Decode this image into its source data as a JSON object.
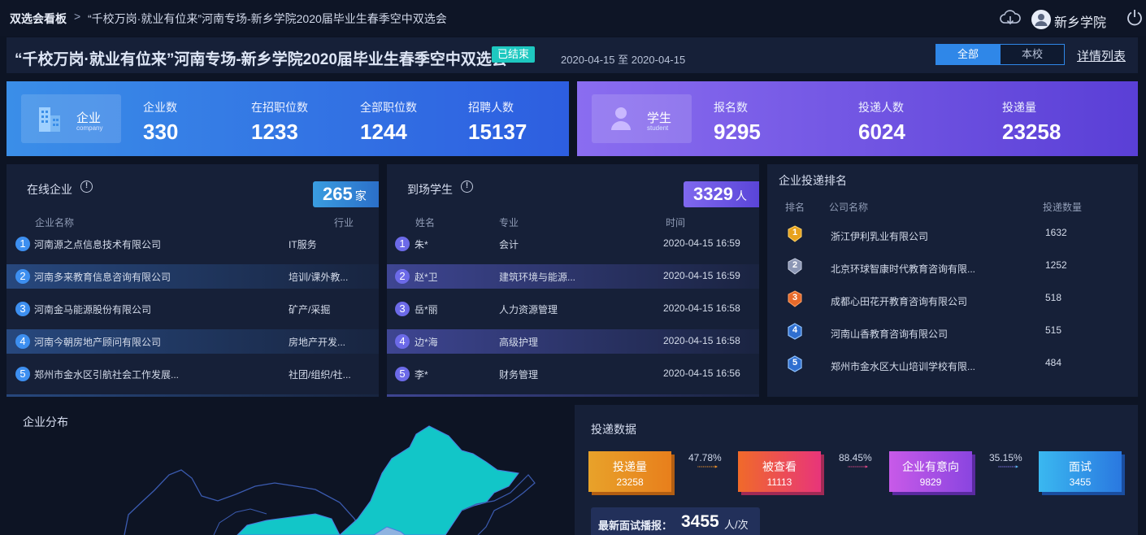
{
  "topbar": {
    "breadcrumb_home": "双选会看板",
    "breadcrumb_sep": ">",
    "breadcrumb_current": "“千校万岗·就业有位来”河南专场-新乡学院2020届毕业生春季空中双选会",
    "school_name": "新乡学院"
  },
  "titlebar": {
    "title": "“千校万岗·就业有位来”河南专场-新乡学院2020届毕业生春季空中双选会",
    "status_badge": "已结束",
    "date_range": "2020-04-15 至 2020-04-15",
    "filter_all": "全部",
    "filter_own": "本校",
    "detail_link": "详情列表"
  },
  "company_card": {
    "label": "企业",
    "sublabel": "company",
    "stats": [
      {
        "label": "企业数",
        "value": "330"
      },
      {
        "label": "在招职位数",
        "value": "1233"
      },
      {
        "label": "全部职位数",
        "value": "1244"
      },
      {
        "label": "招聘人数",
        "value": "15137"
      }
    ]
  },
  "student_card": {
    "label": "学生",
    "sublabel": "student",
    "stats": [
      {
        "label": "报名数",
        "value": "9295"
      },
      {
        "label": "投递人数",
        "value": "6024"
      },
      {
        "label": "投递量",
        "value": "23258"
      }
    ]
  },
  "online_companies": {
    "title": "在线企业",
    "count": "265",
    "count_unit": "家",
    "col_name": "企业名称",
    "col_industry": "行业",
    "rows": [
      {
        "n": "1",
        "name": "河南源之点信息技术有限公司",
        "industry": "IT服务"
      },
      {
        "n": "2",
        "name": "河南多来教育信息咨询有限公司",
        "industry": "培训/课外教..."
      },
      {
        "n": "3",
        "name": "河南金马能源股份有限公司",
        "industry": "矿产/采掘"
      },
      {
        "n": "4",
        "name": "河南今朝房地产顾问有限公司",
        "industry": "房地产开发..."
      },
      {
        "n": "5",
        "name": "郑州市金水区引航社会工作发展...",
        "industry": "社团/组织/社..."
      }
    ]
  },
  "arrived_students": {
    "title": "到场学生",
    "count": "3329",
    "count_unit": "人",
    "col_name": "姓名",
    "col_major": "专业",
    "col_time": "时间",
    "rows": [
      {
        "n": "1",
        "name": "朱*",
        "major": "会计",
        "time": "2020-04-15 16:59"
      },
      {
        "n": "2",
        "name": "赵*卫",
        "major": "建筑环境与能源...",
        "time": "2020-04-15 16:59"
      },
      {
        "n": "3",
        "name": "岳*丽",
        "major": "人力资源管理",
        "time": "2020-04-15 16:58"
      },
      {
        "n": "4",
        "name": "边*海",
        "major": "高级护理",
        "time": "2020-04-15 16:58"
      },
      {
        "n": "5",
        "name": "李*",
        "major": "财务管理",
        "time": "2020-04-15 16:56"
      }
    ]
  },
  "ranking": {
    "title": "企业投递排名",
    "col_rank": "排名",
    "col_company": "公司名称",
    "col_count": "投递数量",
    "rows": [
      {
        "rank": "1",
        "company": "浙江伊利乳业有限公司",
        "count": "1632",
        "color": "#e8a21c"
      },
      {
        "rank": "2",
        "company": "北京环球智康时代教育咨询有限...",
        "count": "1252",
        "color": "#8b96b4"
      },
      {
        "rank": "3",
        "company": "成都心田花开教育咨询有限公司",
        "count": "518",
        "color": "#e86a2a"
      },
      {
        "rank": "4",
        "company": "河南山香教育咨询有限公司",
        "count": "515",
        "color": "#3a8ee8"
      },
      {
        "rank": "5",
        "company": "郑州市金水区大山培训学校有限...",
        "count": "484",
        "color": "#3a8ee8"
      }
    ]
  },
  "distribution": {
    "title": "企业分布"
  },
  "delivery": {
    "title": "投递数据",
    "steps": [
      {
        "label": "投递量",
        "value": "23258"
      },
      {
        "label": "被查看",
        "value": "11113"
      },
      {
        "label": "企业有意向",
        "value": "9829"
      },
      {
        "label": "面试",
        "value": "3455"
      }
    ],
    "rates": [
      "47.78%",
      "88.45%",
      "35.15%"
    ],
    "broadcast_label": "最新面试播报：",
    "broadcast_value": "3455",
    "broadcast_unit": "人/次"
  }
}
